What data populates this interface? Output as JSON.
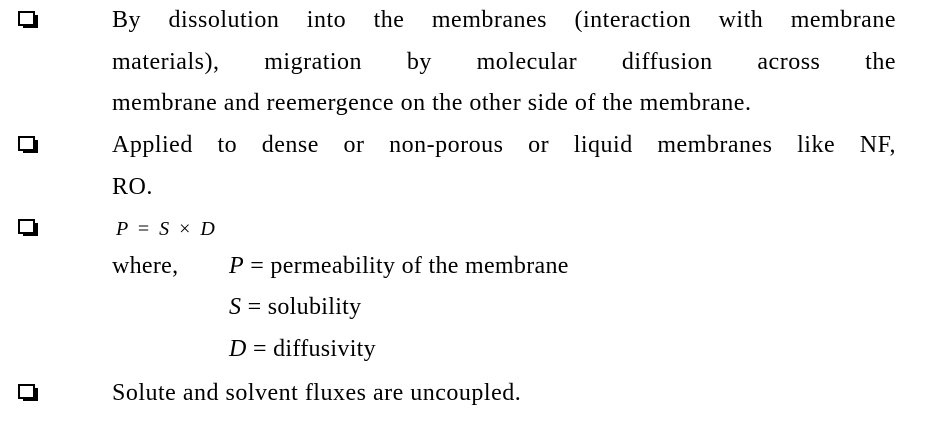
{
  "bullets": {
    "icon": "checkbox-bullet-icon",
    "color": "#000000"
  },
  "item1": {
    "line1": "By dissolution into the membranes (interaction with membrane",
    "line2": "materials), migration by molecular diffusion across the",
    "line3": "membrane and reemergence on the other side of the membrane."
  },
  "item2": {
    "line1": "Applied to dense or non-porous or liquid membranes like NF,",
    "line2": "RO."
  },
  "item3": {
    "formula": {
      "lhs": "P",
      "eq": "=",
      "s": "S",
      "times": "×",
      "d": "D"
    },
    "where_label": "where,",
    "definitions": [
      {
        "symbol": "P",
        "text": " = permeability of the membrane"
      },
      {
        "symbol": "S",
        "text": " = solubility"
      },
      {
        "symbol": "D",
        "text": " = diffusivity"
      }
    ]
  },
  "item4": {
    "line1": "Solute and solvent fluxes are uncoupled."
  }
}
